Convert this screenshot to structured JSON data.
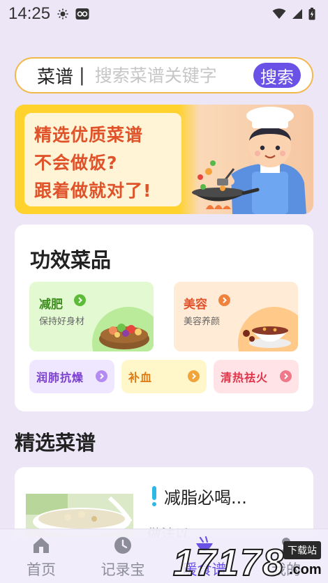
{
  "status_bar": {
    "time": "14:25",
    "icons": [
      "brightness-icon",
      "app-notification-icon",
      "wifi-icon",
      "signal-icon",
      "battery-icon"
    ]
  },
  "search": {
    "category": "菜谱",
    "separator": "|",
    "placeholder": "搜索菜谱关键字",
    "button_label": "搜索"
  },
  "banner": {
    "lines": [
      "精选优质菜谱",
      "不会做饭?",
      "跟着做就对了!"
    ]
  },
  "effect_section": {
    "title": "功效菜品",
    "big_tiles": [
      {
        "name": "减肥",
        "sub": "保持好身材",
        "color": "#3E8E1E",
        "bg": "#E3F9D2",
        "arrow": "#5DBB3A",
        "icon": "salad-bowl-icon"
      },
      {
        "name": "美容",
        "sub": "美容养颜",
        "color": "#E0532A",
        "bg": "#FFEBD6",
        "arrow": "#F0823C",
        "icon": "soup-bowl-icon"
      }
    ],
    "small_tiles": [
      {
        "name": "润肺抗燥",
        "color": "#7A3FD0",
        "bg": "#EFE6FF",
        "arrow": "#B48BF0"
      },
      {
        "name": "补血",
        "color": "#E07A12",
        "bg": "#FFF6C9",
        "arrow": "#F2A33A"
      },
      {
        "name": "清热祛火",
        "color": "#E0344A",
        "bg": "#FFE3E6",
        "arrow": "#F07888"
      }
    ]
  },
  "featured": {
    "title": "精选菜谱",
    "recipe": {
      "title": "减脂必喝...",
      "desc": "做法以…"
    }
  },
  "tabs": [
    {
      "label": "首页",
      "icon": "home-icon",
      "active": false
    },
    {
      "label": "记录宝",
      "icon": "clock-icon",
      "active": false
    },
    {
      "label": "暖食谱",
      "icon": "bowl-icon",
      "active": true
    },
    {
      "label": "我的",
      "icon": "user-icon",
      "active": false
    }
  ],
  "watermark": {
    "digits": "17178",
    "badge": "下载站",
    "suffix": ".com"
  },
  "colors": {
    "accent": "#6A52E6",
    "page_bg": "#ECE6F7",
    "search_border": "#F2B84A",
    "banner_text": "#E0532A"
  }
}
